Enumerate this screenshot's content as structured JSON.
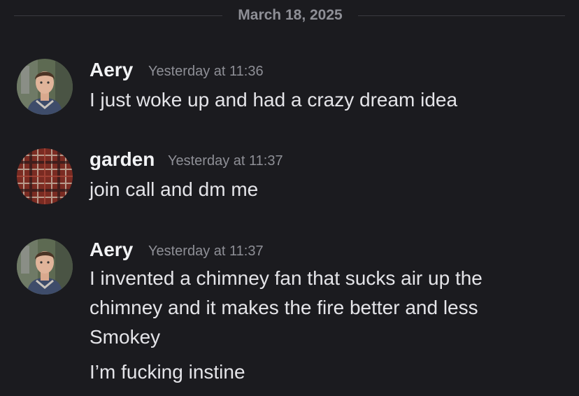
{
  "date_divider": "March 18, 2025",
  "messages": [
    {
      "author": "Aery",
      "timestamp": "Yesterday at 11:36",
      "lines": [
        "I just woke up and had a crazy dream idea"
      ],
      "avatar_icon": "person-photo-avatar"
    },
    {
      "author": "garden",
      "timestamp": "Yesterday at 11:37",
      "lines": [
        "join call and dm me"
      ],
      "avatar_icon": "plaid-pattern-avatar"
    },
    {
      "author": "Aery",
      "timestamp": "Yesterday at 11:37",
      "lines": [
        "I invented a chimney fan that sucks air up the chimney and it makes the fire better and less Smokey",
        "I’m fucking instine"
      ],
      "avatar_icon": "person-photo-avatar"
    }
  ],
  "colors": {
    "background": "#1b1b1f",
    "username": "#f2f3f5",
    "timestamp": "#8e8f96",
    "message_text": "#e4e4e8"
  }
}
